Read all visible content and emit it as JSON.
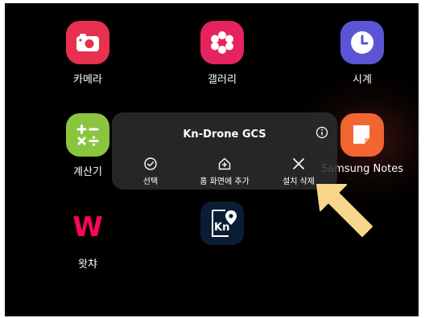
{
  "apps": [
    {
      "label": "카메라",
      "icon": "camera-icon",
      "color": "#e8304f"
    },
    {
      "label": "갤러리",
      "icon": "gallery-flower-icon",
      "color": "#e5245f"
    },
    {
      "label": "시계",
      "icon": "clock-icon",
      "color": "#5b55d6"
    },
    {
      "label": "계산기",
      "icon": "calculator-icon",
      "color": "#8bc53f"
    },
    {
      "label": "Samsung Notes",
      "icon": "notes-icon",
      "color": "#f26531"
    },
    {
      "label": "왓챠",
      "icon": "watcha-icon",
      "color": "#ff0558"
    },
    {
      "label": "",
      "icon": "kn-drone-gcs-icon",
      "color": "#0b1d34"
    }
  ],
  "popup": {
    "title": "Kn-Drone GCS",
    "info_icon": "info-icon",
    "actions": [
      {
        "label": "선택",
        "icon": "check-circle-icon"
      },
      {
        "label": "홈 화면에 추가",
        "icon": "add-home-icon"
      },
      {
        "label": "설치 삭제",
        "icon": "close-x-icon"
      }
    ]
  },
  "watcha_letter": "W",
  "kn_icon_text": "Kn",
  "pointer_arrow_color": "#f8d58a"
}
